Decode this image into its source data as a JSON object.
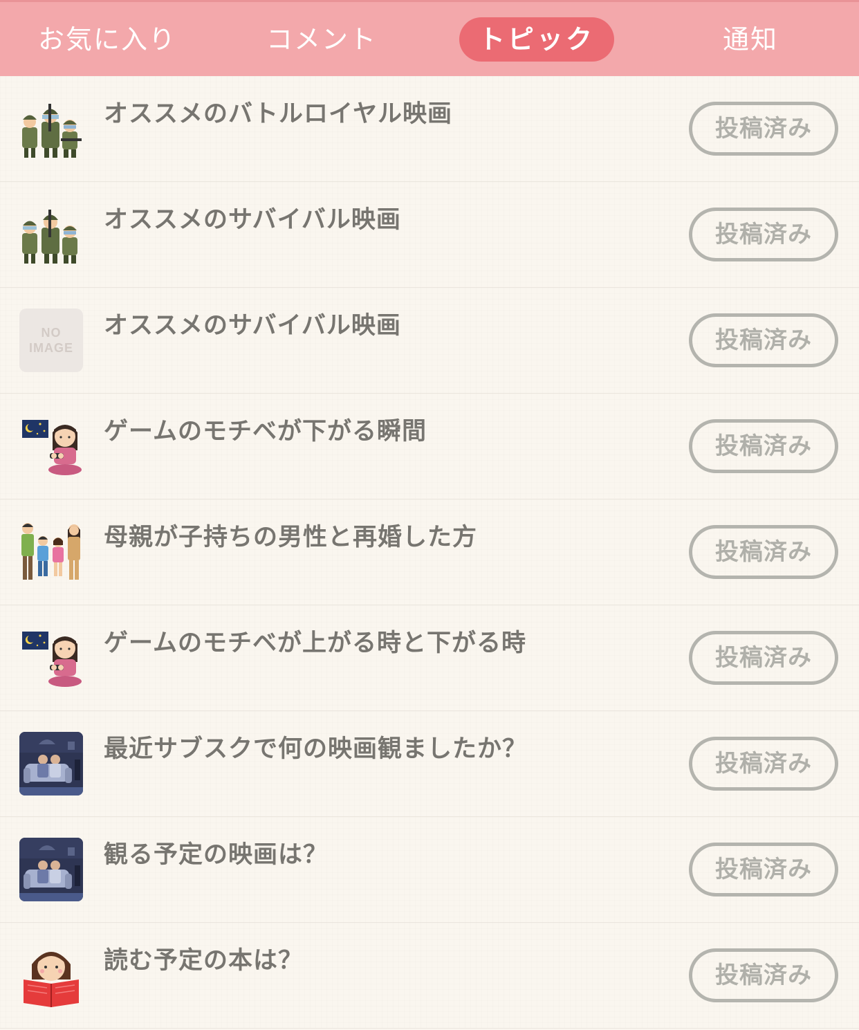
{
  "tabs": [
    {
      "label": "お気に入り",
      "active": false
    },
    {
      "label": "コメント",
      "active": false
    },
    {
      "label": "トピック",
      "active": true
    },
    {
      "label": "通知",
      "active": false
    }
  ],
  "colors": {
    "tabbar_bg": "#f3a8ab",
    "tab_active_bg": "#eb6b73",
    "list_bg": "#faf6ef",
    "title_text": "#777570",
    "posted_button": "#b4b4ae"
  },
  "topics": [
    {
      "title": "オススメのバトルロイヤル映画",
      "thumbnail": "soldiers-illustration",
      "status": "投稿済み"
    },
    {
      "title": "オススメのサバイバル映画",
      "thumbnail": "soldiers-illustration",
      "status": "投稿済み"
    },
    {
      "title": "オススメのサバイバル映画",
      "thumbnail": "no-image",
      "no_image_line1": "NO",
      "no_image_line2": "IMAGE",
      "status": "投稿済み"
    },
    {
      "title": "ゲームのモチベが下がる瞬間",
      "thumbnail": "girl-gaming-at-night-illustration",
      "status": "投稿済み"
    },
    {
      "title": "母親が子持ちの男性と再婚した方",
      "thumbnail": "family-illustration",
      "status": "投稿済み"
    },
    {
      "title": "ゲームのモチベが上がる時と下がる時",
      "thumbnail": "girl-gaming-at-night-illustration",
      "status": "投稿済み"
    },
    {
      "title": "最近サブスクで何の映画観ましたか？",
      "thumbnail": "couple-watching-tv-illustration",
      "status": "投稿済み"
    },
    {
      "title": "観る予定の映画は？",
      "thumbnail": "couple-watching-tv-illustration",
      "status": "投稿済み"
    },
    {
      "title": "読む予定の本は？",
      "thumbnail": "girl-reading-book-illustration",
      "status": "投稿済み"
    }
  ]
}
